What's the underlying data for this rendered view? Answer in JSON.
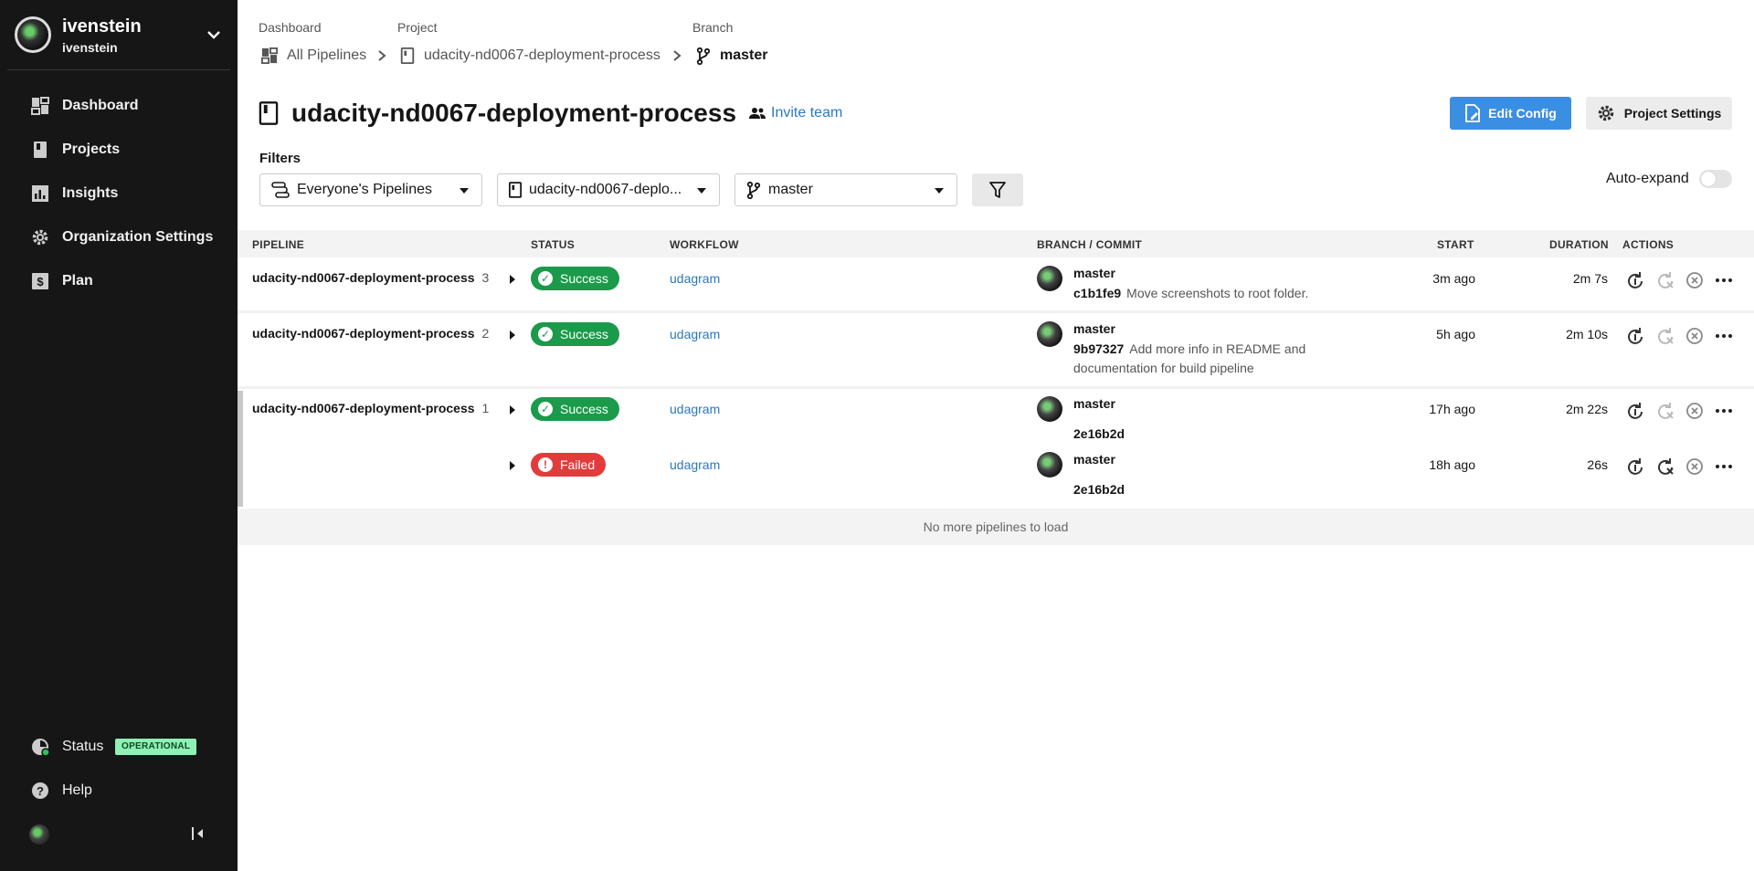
{
  "org": {
    "name": "ivenstein",
    "user": "ivenstein"
  },
  "nav": {
    "items": [
      {
        "label": "Dashboard",
        "icon": "dashboard-icon"
      },
      {
        "label": "Projects",
        "icon": "project-icon"
      },
      {
        "label": "Insights",
        "icon": "insights-icon"
      },
      {
        "label": "Organization Settings",
        "icon": "gear-icon"
      },
      {
        "label": "Plan",
        "icon": "dollar-icon"
      }
    ],
    "status_label": "Status",
    "status_badge": "OPERATIONAL",
    "help_label": "Help"
  },
  "breadcrumb": {
    "dashboard_label": "Dashboard",
    "dashboard_value": "All Pipelines",
    "project_label": "Project",
    "project_value": "udacity-nd0067-deployment-process",
    "branch_label": "Branch",
    "branch_value": "master"
  },
  "header": {
    "title": "udacity-nd0067-deployment-process",
    "invite": "Invite team",
    "edit_config": "Edit Config",
    "project_settings": "Project Settings"
  },
  "filters": {
    "label": "Filters",
    "pipelines": "Everyone's Pipelines",
    "project": "udacity-nd0067-deplo...",
    "branch": "master",
    "auto_expand": "Auto-expand",
    "auto_expand_on": false
  },
  "table": {
    "headers": [
      "PIPELINE",
      "STATUS",
      "WORKFLOW",
      "BRANCH / COMMIT",
      "START",
      "DURATION",
      "ACTIONS"
    ],
    "rows": [
      {
        "pipeline": "udacity-nd0067-deployment-process",
        "number": "3",
        "status": "Success",
        "workflow": "udagram",
        "branch": "master",
        "commit": "c1b1fe9",
        "message": "Move screenshots to root folder.",
        "start": "3m ago",
        "duration": "2m 7s"
      },
      {
        "pipeline": "udacity-nd0067-deployment-process",
        "number": "2",
        "status": "Success",
        "workflow": "udagram",
        "branch": "master",
        "commit": "9b97327",
        "message": "Add more info in README and documentation for build pipeline",
        "start": "5h ago",
        "duration": "2m 10s"
      },
      {
        "pipeline": "udacity-nd0067-deployment-process",
        "number": "1",
        "status": "Success",
        "workflow": "udagram",
        "branch": "master",
        "commit": "2e16b2d",
        "message": "",
        "start": "17h ago",
        "duration": "2m 22s"
      },
      {
        "pipeline": "",
        "number": "",
        "status": "Failed",
        "workflow": "udagram",
        "branch": "master",
        "commit": "2e16b2d",
        "message": "",
        "start": "18h ago",
        "duration": "26s"
      }
    ],
    "footer": "No more pipelines to load"
  },
  "colors": {
    "sidebar": "#161616",
    "success": "#1a9a4a",
    "failed": "#e33b3b",
    "link": "#2a78c2",
    "primary": "#3b8fe3"
  }
}
